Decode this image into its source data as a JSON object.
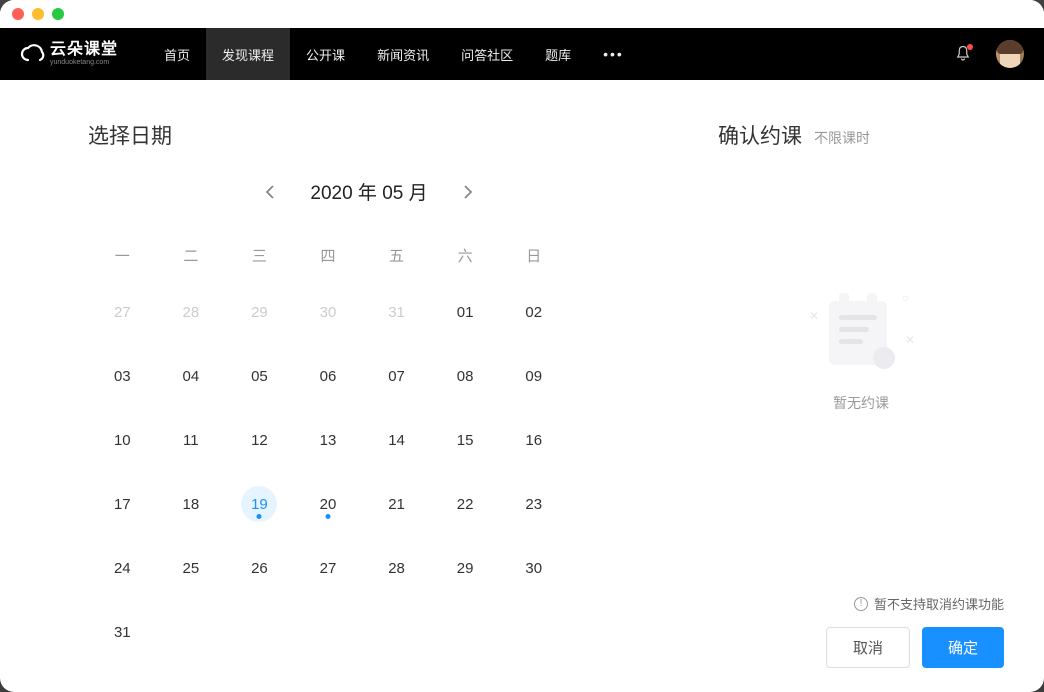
{
  "logo": {
    "main": "云朵课堂",
    "sub": "yunduoketang.com"
  },
  "nav": {
    "items": [
      {
        "label": "首页",
        "active": false
      },
      {
        "label": "发现课程",
        "active": true
      },
      {
        "label": "公开课",
        "active": false
      },
      {
        "label": "新闻资讯",
        "active": false
      },
      {
        "label": "问答社区",
        "active": false
      },
      {
        "label": "题库",
        "active": false
      }
    ]
  },
  "calendar": {
    "title": "选择日期",
    "month_label": "2020 年 05 月",
    "weekdays": [
      "一",
      "二",
      "三",
      "四",
      "五",
      "六",
      "日"
    ],
    "cells": [
      {
        "d": "27",
        "muted": true
      },
      {
        "d": "28",
        "muted": true
      },
      {
        "d": "29",
        "muted": true
      },
      {
        "d": "30",
        "muted": true
      },
      {
        "d": "31",
        "muted": true
      },
      {
        "d": "01"
      },
      {
        "d": "02"
      },
      {
        "d": "03"
      },
      {
        "d": "04"
      },
      {
        "d": "05"
      },
      {
        "d": "06"
      },
      {
        "d": "07"
      },
      {
        "d": "08"
      },
      {
        "d": "09"
      },
      {
        "d": "10"
      },
      {
        "d": "11"
      },
      {
        "d": "12"
      },
      {
        "d": "13"
      },
      {
        "d": "14"
      },
      {
        "d": "15"
      },
      {
        "d": "16"
      },
      {
        "d": "17"
      },
      {
        "d": "18"
      },
      {
        "d": "19",
        "selected": true,
        "dot": true
      },
      {
        "d": "20",
        "dot": true
      },
      {
        "d": "21"
      },
      {
        "d": "22"
      },
      {
        "d": "23"
      },
      {
        "d": "24"
      },
      {
        "d": "25"
      },
      {
        "d": "26"
      },
      {
        "d": "27"
      },
      {
        "d": "28"
      },
      {
        "d": "29"
      },
      {
        "d": "30"
      },
      {
        "d": "31"
      }
    ]
  },
  "booking": {
    "title": "确认约课",
    "subtitle": "不限课时",
    "empty_text": "暂无约课",
    "footer_note": "暂不支持取消约课功能",
    "cancel_label": "取消",
    "confirm_label": "确定"
  }
}
